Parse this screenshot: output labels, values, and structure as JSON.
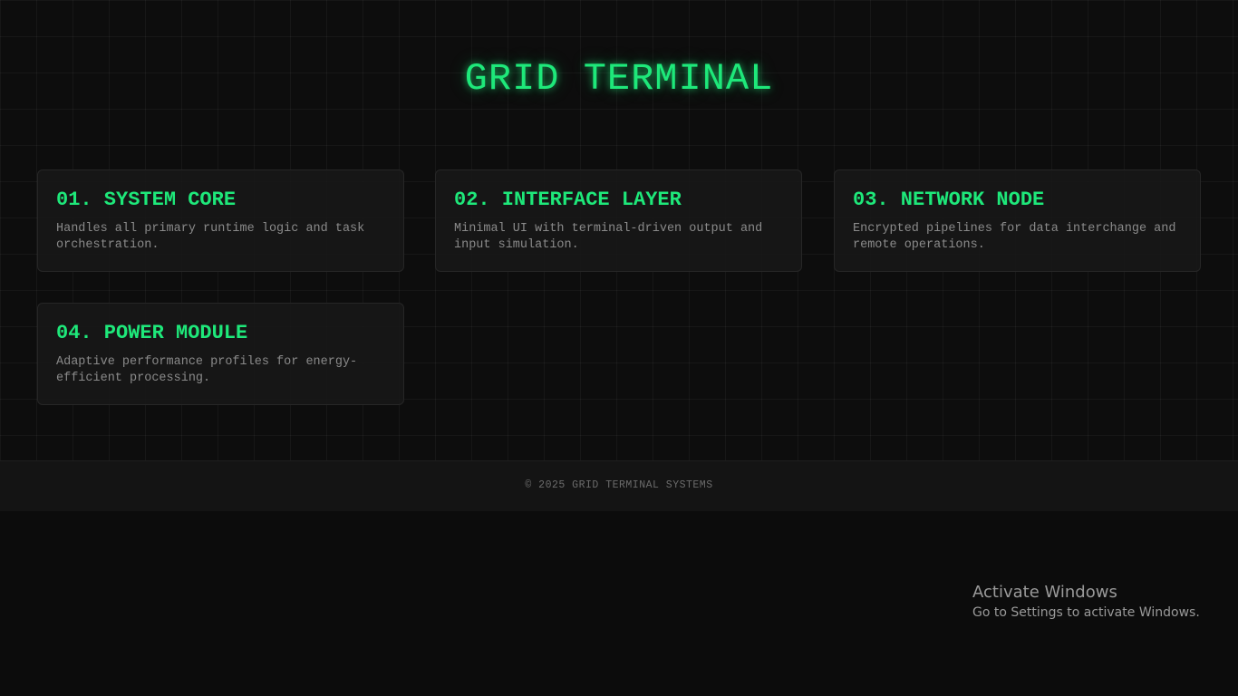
{
  "header": {
    "title": "GRID TERMINAL"
  },
  "cards": [
    {
      "title": "01. SYSTEM CORE",
      "description": "Handles all primary runtime logic and task orchestration."
    },
    {
      "title": "02. INTERFACE LAYER",
      "description": "Minimal UI with terminal-driven output and input simulation."
    },
    {
      "title": "03. NETWORK NODE",
      "description": "Encrypted pipelines for data interchange and remote operations."
    },
    {
      "title": "04. POWER MODULE",
      "description": "Adaptive performance profiles for energy-efficient processing."
    }
  ],
  "footer": {
    "text": "© 2025 GRID TERMINAL SYSTEMS"
  },
  "os_watermark": {
    "title": "Activate Windows",
    "subtitle": "Go to Settings to activate Windows."
  },
  "colors": {
    "accent": "#1ee87a",
    "background": "#0c0c0c",
    "card_background": "#181818",
    "muted_text": "#8a8a8a"
  }
}
